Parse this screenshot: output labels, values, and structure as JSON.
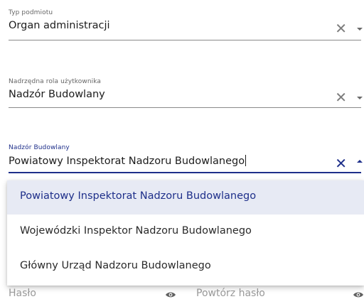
{
  "fields": {
    "entity_type": {
      "label": "Typ podmiotu",
      "value": "Organ administracji"
    },
    "parent_role": {
      "label": "Nadrzędna rola użytkownika",
      "value": "Nadzór Budowlany"
    },
    "supervision": {
      "label": "Nadzór Budowlany",
      "value": "Powiatowy Inspektorat Nadzoru Budowlanego"
    }
  },
  "clear_symbol": "✕",
  "dropdown": {
    "options": [
      "Powiatowy Inspektorat Nadzoru Budowlanego",
      "Wojewódzki Inspektor Nadzoru Budowlanego",
      "Główny Urząd Nadzoru Budowlanego"
    ],
    "selected_index": 0
  },
  "password": {
    "label": "Hasło"
  },
  "repeat_password": {
    "label": "Powtórz hasło"
  },
  "colors": {
    "accent": "#1e2f8a",
    "selected_bg": "#e7eaf4"
  },
  "icons": {
    "clear": "close-icon",
    "toggle": "chevron-down-icon",
    "visibility": "eye-icon"
  }
}
